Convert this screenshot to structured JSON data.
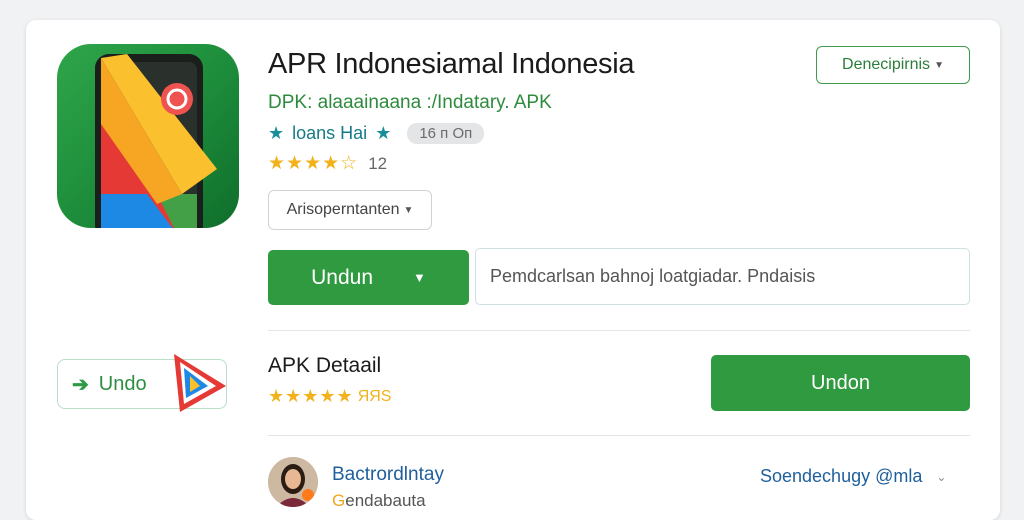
{
  "app": {
    "title": "APR Indonesiamal Indonesia",
    "subtitle": "DPK: alaaainaana :/Indatary. APK",
    "developer_badge": "loans Hai",
    "size": "16 п Оп",
    "rating_count": "12",
    "rating_stars": 4.5
  },
  "controls": {
    "top_select": "Denecipirnis",
    "small_dropdown": "Arisoperntanten",
    "download_button": "Undun",
    "search_placeholder": "Pemdcarlsan bahnoj loatgiadar. Pndaisis"
  },
  "detail": {
    "undo_label": "Undo",
    "section_title": "APK Detaail",
    "rating_text": "ЯЯЅ",
    "download_button": "Undon"
  },
  "developer": {
    "name": "Bactrordlntay",
    "sub_mark": "G",
    "sub_text": "endabauta",
    "right_label": "Soendechugy @mla"
  },
  "colors": {
    "primary_green": "#2f9a40",
    "link_blue": "#1f5f9c",
    "star_yellow": "#f2b21b",
    "teal": "#157a86"
  },
  "icons": {
    "app_icon": "app-logo-icon",
    "star": "star-icon",
    "caret": "chevron-down-icon",
    "undo_arrow": "arrow-right-icon",
    "play": "play-logo-icon"
  }
}
